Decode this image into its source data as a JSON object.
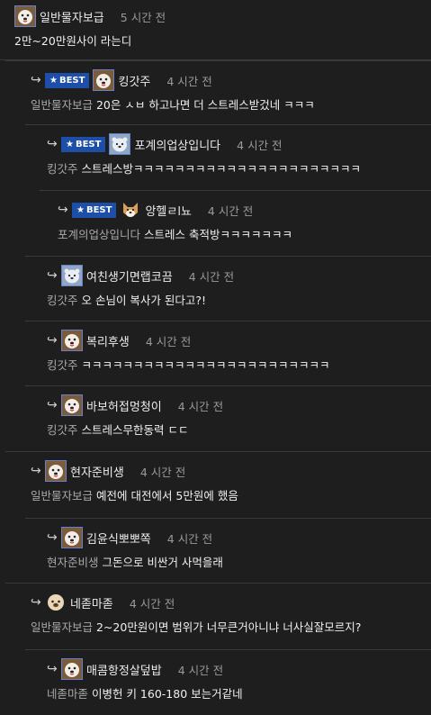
{
  "comments": [
    {
      "author": "일반물자보급",
      "time": "5 시간 전",
      "mention": "",
      "text": "2만~20만원사이 라는디",
      "best": false,
      "avatar": "dog-avatar"
    },
    {
      "author": "킹갓주",
      "time": "4 시간 전",
      "mention": "일반물자보급 ",
      "text": "20은 ㅅㅂ 하고나면 더 스트레스받겄네 ㅋㅋㅋ",
      "best": true,
      "avatar": "dog-avatar"
    },
    {
      "author": "포계의업상입니다",
      "time": "4 시간 전",
      "mention": "킹갓주 ",
      "text": "스트레스방ㅋㅋㅋㅋㅋㅋㅋㅋㅋㅋㅋㅋㅋㅋㅋㅋㅋㅋㅋㅋㅋㅋ",
      "best": true,
      "avatar": "bear-avatar"
    },
    {
      "author": "앙헬ㄹl뇨",
      "time": "4 시간 전",
      "mention": "포계의업상입니다 ",
      "text": "스트레스 축적방ㅋㅋㅋㅋㅋㅋㅋ",
      "best": true,
      "avatar": "shiba-avatar"
    },
    {
      "author": "여친생기면랩코끔",
      "time": "4 시간 전",
      "mention": "킹갓주 ",
      "text": "오 손님이 복사가 된다고?!",
      "best": false,
      "avatar": "bear-avatar"
    },
    {
      "author": "복리후생",
      "time": "4 시간 전",
      "mention": "킹갓주 ",
      "text": "ㅋㅋㅋㅋㅋㅋㅋㅋㅋㅋㅋㅋㅋㅋㅋㅋㅋㅋㅋㅋㅋㅋㅋㅋ",
      "best": false,
      "avatar": "dog-avatar"
    },
    {
      "author": "바보허접멍청이",
      "time": "4 시간 전",
      "mention": "킹갓주 ",
      "text": "스트레스무한동력 ㄷㄷ",
      "best": false,
      "avatar": "dog-avatar"
    },
    {
      "author": "현자준비생",
      "time": "4 시간 전",
      "mention": "일반물자보급 ",
      "text": "예전에 대전에서 5만원에 했음",
      "best": false,
      "avatar": "dog-avatar"
    },
    {
      "author": "김윤식뽀뽀쪽",
      "time": "4 시간 전",
      "mention": "현자준비생 ",
      "text": "그돈으로 비싼거 사먹을래",
      "best": false,
      "avatar": "dog-avatar"
    },
    {
      "author": "네졷마졷",
      "time": "4 시간 전",
      "mention": "일반물자보급 ",
      "text": "2~20만원이면 범위가 너무큰거아니냐 너사실잘모르지?",
      "best": false,
      "avatar": "pug-avatar"
    },
    {
      "author": "매콤항정살덮밥",
      "time": "4 시간 전",
      "mention": "네졷마졷 ",
      "text": "이병헌 키 160-180 보는거같네",
      "best": false,
      "avatar": "dog-avatar"
    }
  ],
  "badge_label": "BEST",
  "colors": {
    "background": "#1e1e1e",
    "badge": "#1d4fa8",
    "divider": "#3a3a3a",
    "muted": "#9a9a9a"
  }
}
